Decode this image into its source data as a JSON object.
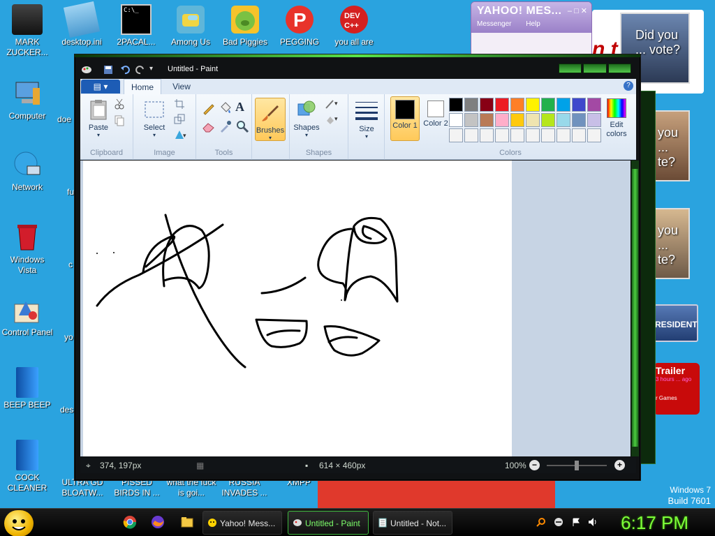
{
  "desktop": {
    "icons_left": [
      {
        "label": "MARK ZUCKER...",
        "icon": "person-icon"
      },
      {
        "label": "Computer",
        "icon": "computer-icon"
      },
      {
        "label": "Network",
        "icon": "network-icon"
      },
      {
        "label": "Windows Vista",
        "icon": "recycle-bin-icon"
      },
      {
        "label": "Control Panel",
        "icon": "control-panel-icon"
      },
      {
        "label": "BEEP BEEP",
        "icon": "blue-file-icon"
      },
      {
        "label": "COCK CLEANER",
        "icon": "blue-file-icon"
      }
    ],
    "icons_top": [
      {
        "label": "desktop.ini",
        "icon": "settings-file-icon"
      },
      {
        "label": "2PACAL...",
        "icon": "console-icon"
      },
      {
        "label": "Among Us",
        "icon": "among-us-icon"
      },
      {
        "label": "Bad Piggies",
        "icon": "bad-piggies-icon"
      },
      {
        "label": "PEGGING",
        "icon": "p-logo-icon"
      },
      {
        "label": "you all are",
        "icon": "devcpp-icon"
      }
    ],
    "partial_icons": [
      "doe",
      "fu",
      "c",
      "yo",
      "des"
    ],
    "bottom_labels": [
      "ULTRA GD BLOATW...",
      "PISSED BIRDS IN ...",
      "what the fuck is goi...",
      "RUSSIA INVADES ...",
      "XMPP"
    ],
    "build_info": {
      "line1": "Windows 7",
      "line2": "Build 7601"
    }
  },
  "yahoo": {
    "logo": "YAHOO! MES...",
    "menu": [
      "Messenger",
      "Help"
    ]
  },
  "ads": {
    "red_text": "n t",
    "photo1": "Did you ... vote?",
    "photo2": "you ... te?",
    "photo3": "you ... te?",
    "badge1": "RESIDENT",
    "badge2_title": "Trailer",
    "badge2_sub": "3 hours ... ago",
    "badge2_foot": "r Games"
  },
  "paint": {
    "title": "Untitled - Paint",
    "tabs": [
      "Home",
      "View"
    ],
    "groups": {
      "clipboard": {
        "caption": "Clipboard",
        "paste": "Paste"
      },
      "image": {
        "caption": "Image",
        "select": "Select"
      },
      "tools": {
        "caption": "Tools"
      },
      "brushes": {
        "label": "Brushes"
      },
      "shapes": {
        "caption": "Shapes",
        "label": "Shapes"
      },
      "size": {
        "label": "Size"
      },
      "colors": {
        "caption": "Colors",
        "color1": "Color 1",
        "color2": "Color 2",
        "edit": "Edit colors"
      }
    },
    "color1_value": "#000000",
    "color2_value": "#ffffff",
    "palette": [
      "#000000",
      "#7f7f7f",
      "#880015",
      "#ed1c24",
      "#ff7f27",
      "#fff200",
      "#22b14c",
      "#00a2e8",
      "#3f48cc",
      "#a349a4",
      "#ffffff",
      "#c3c3c3",
      "#b97a57",
      "#ffaec9",
      "#ffc90e",
      "#efe4b0",
      "#b5e61d",
      "#99d9ea",
      "#7092be",
      "#c8bfe7",
      "#f3f3f3",
      "#f3f3f3",
      "#f3f3f3",
      "#f3f3f3",
      "#f3f3f3",
      "#f3f3f3",
      "#f3f3f3",
      "#f3f3f3",
      "#f3f3f3",
      "#f3f3f3"
    ],
    "status": {
      "cursor_pos": "374, 197px",
      "canvas_size": "614 × 460px",
      "zoom": "100%"
    }
  },
  "taskbar": {
    "buttons": [
      {
        "label": "Yahoo! Mess...",
        "icon": "yahoo-icon",
        "active": false
      },
      {
        "label": "Untitled - Paint",
        "icon": "paint-icon",
        "active": true
      },
      {
        "label": "Untitled - Not...",
        "icon": "notepad-icon",
        "active": false
      }
    ],
    "clock": "6:17 PM"
  }
}
